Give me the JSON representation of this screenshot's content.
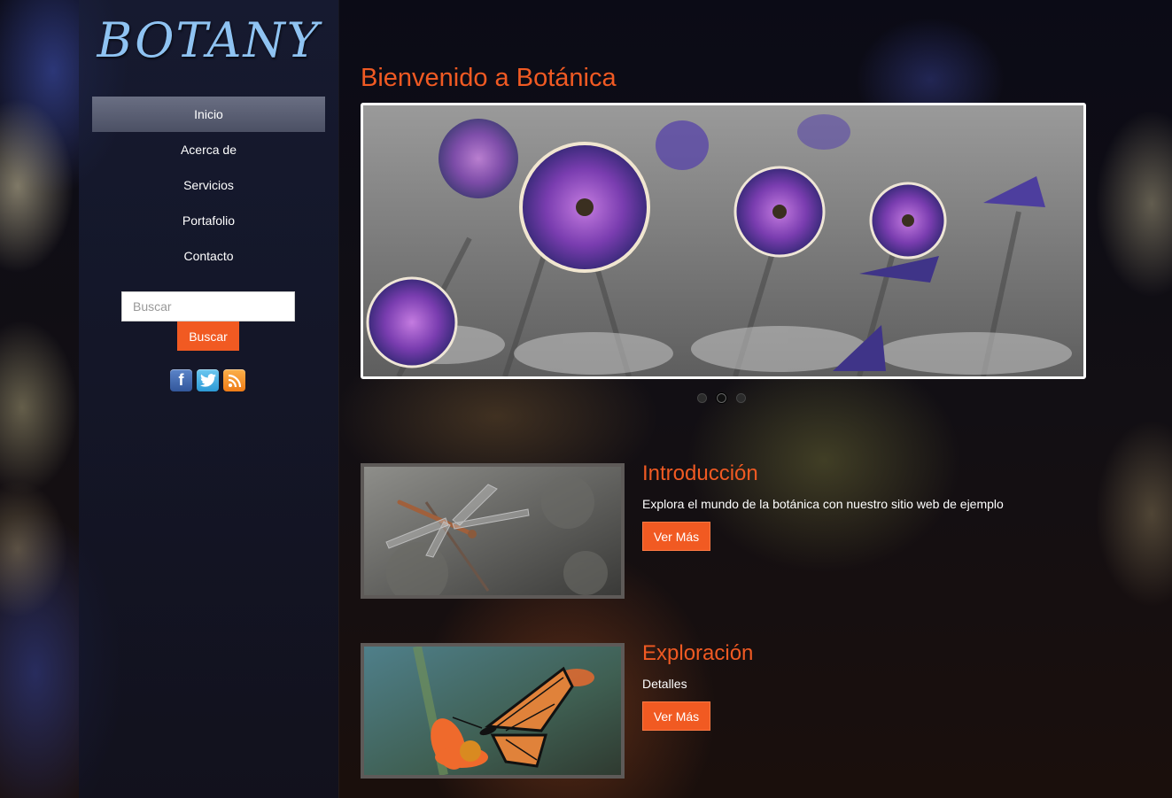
{
  "sidebar": {
    "logo": "BOTANY",
    "nav": [
      {
        "label": "Inicio",
        "active": true
      },
      {
        "label": "Acerca de",
        "active": false
      },
      {
        "label": "Servicios",
        "active": false
      },
      {
        "label": "Portafolio",
        "active": false
      },
      {
        "label": "Contacto",
        "active": false
      }
    ],
    "search": {
      "placeholder": "Buscar",
      "button_label": "Buscar"
    },
    "social": [
      {
        "icon": "facebook-icon",
        "glyph": "f"
      },
      {
        "icon": "twitter-icon",
        "glyph": ""
      },
      {
        "icon": "rss-icon",
        "glyph": ""
      }
    ]
  },
  "main": {
    "title": "Bienvenido a Botánica",
    "slider": {
      "slides": 3,
      "active_slide": 2,
      "image": "purple-petunias-photo"
    },
    "features": [
      {
        "title": "Introducción",
        "text": "Explora el mundo de la botánica con nuestro sitio web de ejemplo",
        "button_label": "Ver Más",
        "image": "dragonfly-photo"
      },
      {
        "title": "Exploración",
        "text": "Detalles",
        "button_label": "Ver Más",
        "image": "butterfly-photo"
      }
    ]
  },
  "colors": {
    "accent": "#f15a22",
    "logo": "#8fc3f2",
    "nav_active_bg": "#6b6f82"
  }
}
